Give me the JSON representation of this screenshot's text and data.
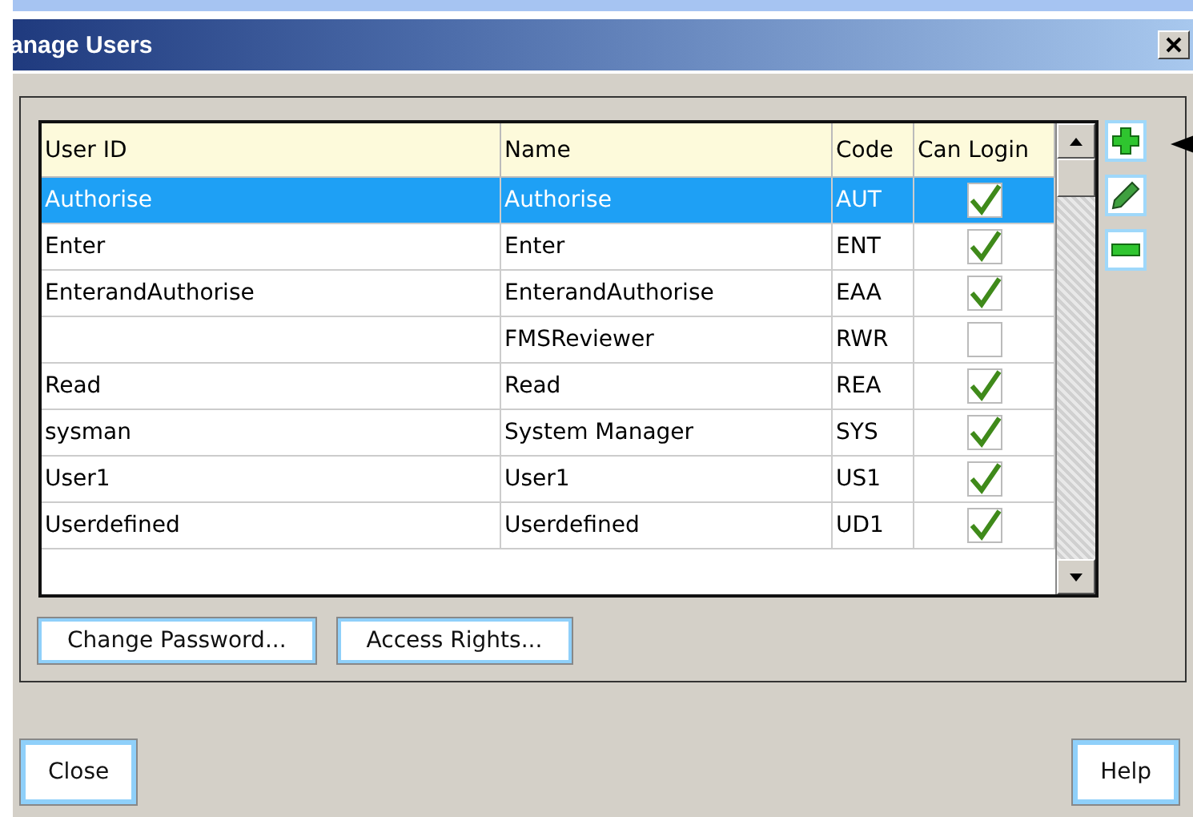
{
  "window": {
    "title": "anage Users"
  },
  "table": {
    "columns": [
      "User ID",
      "Name",
      "Code",
      "Can Login"
    ],
    "rows": [
      {
        "user_id": "Authorise",
        "name": "Authorise",
        "code": "AUT",
        "can_login": true,
        "selected": true
      },
      {
        "user_id": "Enter",
        "name": "Enter",
        "code": "ENT",
        "can_login": true,
        "selected": false
      },
      {
        "user_id": "EnterandAuthorise",
        "name": "EnterandAuthorise",
        "code": "EAA",
        "can_login": true,
        "selected": false
      },
      {
        "user_id": "",
        "name": "FMSReviewer",
        "code": "RWR",
        "can_login": false,
        "selected": false
      },
      {
        "user_id": "Read",
        "name": "Read",
        "code": "REA",
        "can_login": true,
        "selected": false
      },
      {
        "user_id": "sysman",
        "name": "System Manager",
        "code": "SYS",
        "can_login": true,
        "selected": false
      },
      {
        "user_id": "User1",
        "name": "User1",
        "code": "US1",
        "can_login": true,
        "selected": false
      },
      {
        "user_id": "Userdefined",
        "name": "Userdefined",
        "code": "UD1",
        "can_login": true,
        "selected": false
      }
    ]
  },
  "side_buttons": [
    {
      "kind": "add"
    },
    {
      "kind": "edit"
    },
    {
      "kind": "remove"
    }
  ],
  "panel_buttons": [
    "Change Password...",
    "Access Rights..."
  ],
  "footer_buttons": [
    "Close",
    "Help"
  ]
}
